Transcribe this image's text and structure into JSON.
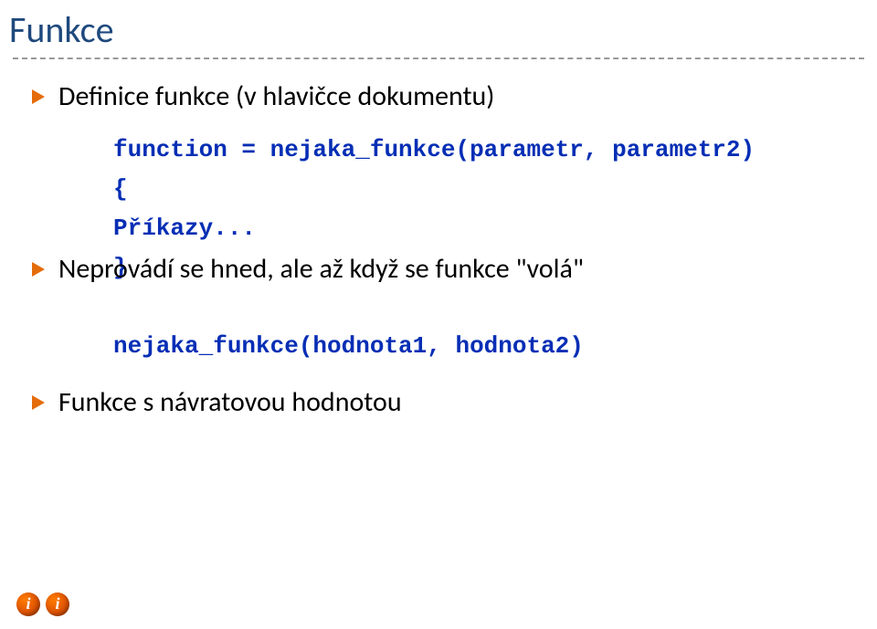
{
  "title": "Funkce",
  "bullets": {
    "b1": "Definice funkce (v hlavičce dokumentu)",
    "b2_prefix": "Ne",
    "b2_rest": "provádí se hned, ale až když se funkce \"volá\"",
    "b3": "Funkce s návratovou hodnotou"
  },
  "code": {
    "line1": "function = nejaka_funkce(parametr, parametr2)",
    "line2": "{",
    "line3": "Příkazy...",
    "line4": "}",
    "call": "nejaka_funkce(hodnota1, hodnota2)"
  },
  "icons": {
    "bullet": "play-bullet",
    "info": "info-icon"
  }
}
